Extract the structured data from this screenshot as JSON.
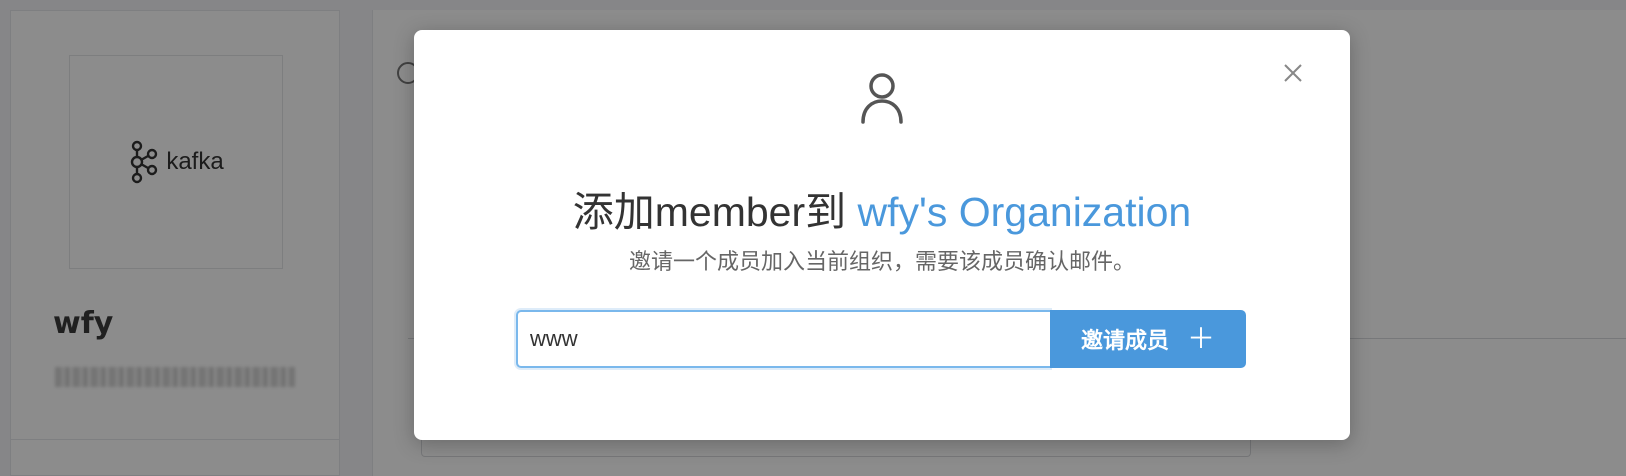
{
  "background": {
    "logo_text": "kafka",
    "org_name": "wfy"
  },
  "modal": {
    "title_prefix": "添加member到 ",
    "title_org": "wfy's Organization",
    "subtitle": "邀请一个成员加入当前组织，需要该成员确认邮件。",
    "input_value": "www",
    "invite_button_label": "邀请成员",
    "close_icon": "close-icon",
    "user_icon": "user-icon"
  },
  "colors": {
    "accent": "#4a98dc",
    "overlay": "rgba(0,0,0,0.45)"
  }
}
